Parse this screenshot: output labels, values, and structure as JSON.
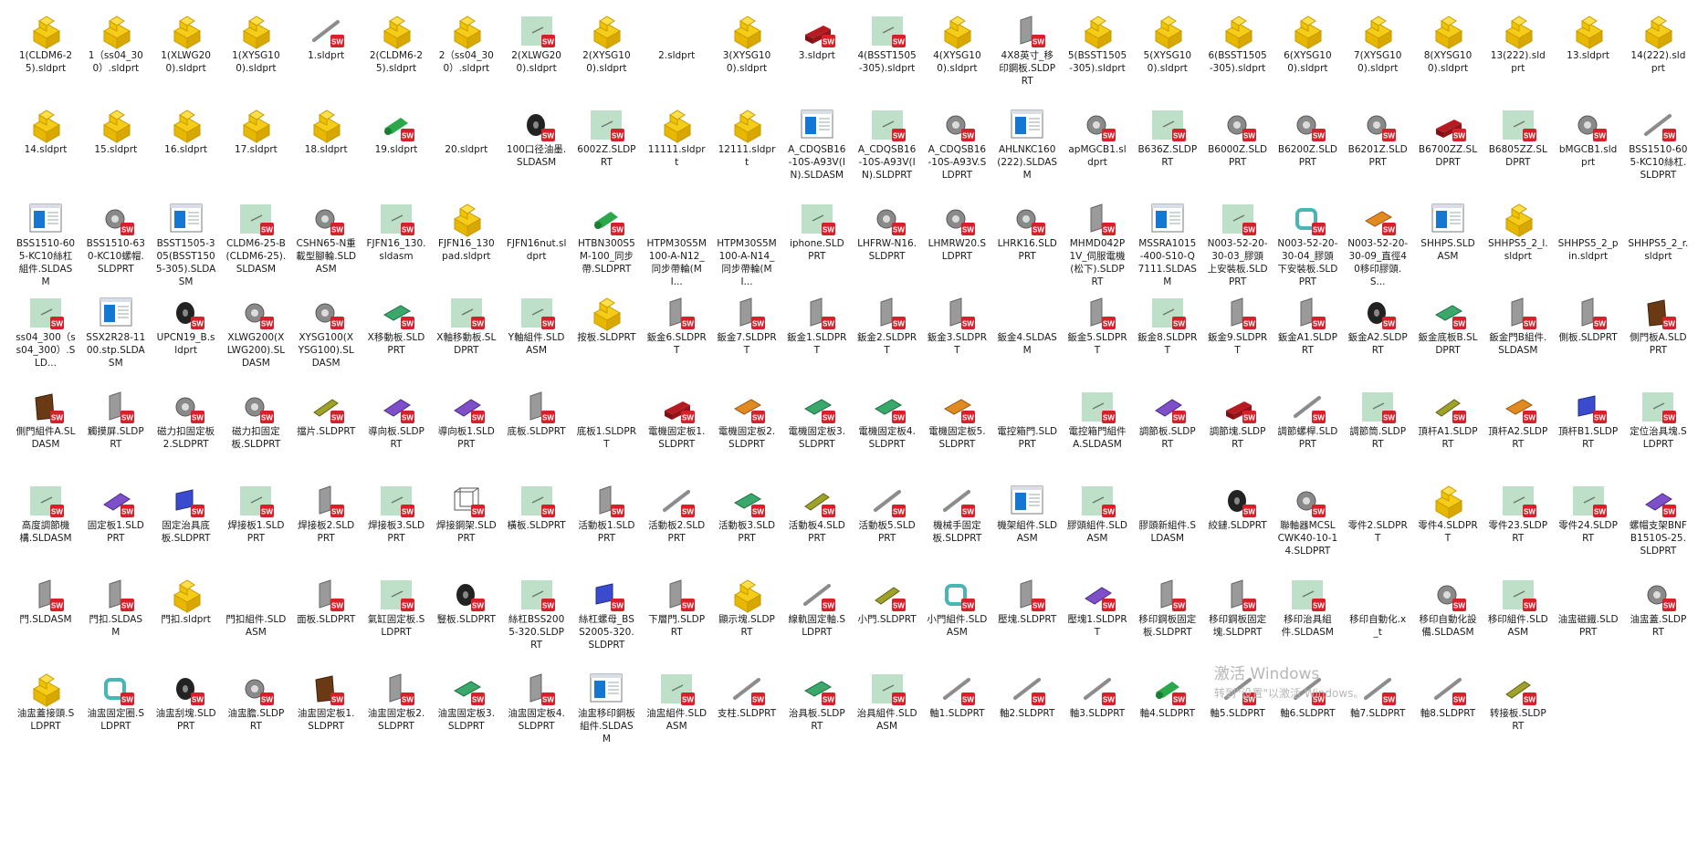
{
  "colors": {
    "folder_yellow": "#f5cc18",
    "folder_edge": "#c79a00",
    "sw_red": "#d8202a",
    "preview_green": "#bfe0c8",
    "doc_blue": "#1478d2"
  },
  "watermark": {
    "title": "激活 Windows",
    "subtitle": "转到\"设置\"以激活 Windows。"
  },
  "rows": [
    [
      {
        "label": "1(CLDM6-25).sldprt",
        "icon": "folder-part-icon"
      },
      {
        "label": "1（ss04_300）.sldprt",
        "icon": "folder-part-icon"
      },
      {
        "label": "1(XLWG200).sldprt",
        "icon": "folder-part-icon"
      },
      {
        "label": "1(XYSG100).sldprt",
        "icon": "folder-part-icon"
      },
      {
        "label": "1.sldprt",
        "icon": "rod-part-icon"
      },
      {
        "label": "2(CLDM6-25).sldprt",
        "icon": "folder-part-icon"
      },
      {
        "label": "2（ss04_300）.sldprt",
        "icon": "folder-part-icon"
      },
      {
        "label": "2(XLWG200).sldprt",
        "icon": "preview-part-icon"
      },
      {
        "label": "2(XYSG100).sldprt",
        "icon": "folder-part-icon"
      },
      {
        "label": "2.sldprt",
        "icon": "blank-icon"
      },
      {
        "label": "3(XYSG100).sldprt",
        "icon": "folder-part-icon"
      },
      {
        "label": "3.sldprt",
        "icon": "red-block-part-icon"
      },
      {
        "label": "4(BSST1505-305).sldprt",
        "icon": "preview-part-icon"
      },
      {
        "label": "4(XYSG100).sldprt",
        "icon": "folder-part-icon"
      },
      {
        "label": "4X8英寸_移印鋼板.SLDPRT",
        "icon": "gray-plate-part-icon"
      },
      {
        "label": "5(BSST1505-305).sldprt",
        "icon": "folder-part-icon"
      },
      {
        "label": "5(XYSG100).sldprt",
        "icon": "folder-part-icon"
      },
      {
        "label": "6(BSST1505-305).sldprt",
        "icon": "folder-part-icon"
      },
      {
        "label": "6(XYSG100).sldprt",
        "icon": "folder-part-icon"
      },
      {
        "label": "7(XYSG100).sldprt",
        "icon": "folder-part-icon"
      },
      {
        "label": "8(XYSG100).sldprt",
        "icon": "folder-part-icon"
      },
      {
        "label": "13(222).sldprt",
        "icon": "folder-part-icon"
      },
      {
        "label": "13.sldprt",
        "icon": "folder-part-icon"
      },
      {
        "label": "14(222).sldprt",
        "icon": "folder-part-icon"
      }
    ],
    [
      {
        "label": "14.sldprt",
        "icon": "folder-part-icon"
      },
      {
        "label": "15.sldprt",
        "icon": "folder-part-icon"
      },
      {
        "label": "16.sldprt",
        "icon": "folder-part-icon"
      },
      {
        "label": "17.sldprt",
        "icon": "folder-part-icon"
      },
      {
        "label": "18.sldprt",
        "icon": "folder-part-icon"
      },
      {
        "label": "19.sldprt",
        "icon": "green-roller-part-icon"
      },
      {
        "label": "20.sldprt",
        "icon": "blank-icon"
      },
      {
        "label": "100口径油墨.SLDASM",
        "icon": "black-wheel-icon"
      },
      {
        "label": "6002Z.SLDPRT",
        "icon": "preview-part-icon"
      },
      {
        "label": "11111.sldprt",
        "icon": "folder-part-icon"
      },
      {
        "label": "12111.sldprt",
        "icon": "folder-part-icon"
      },
      {
        "label": "A_CDQSB16-10S-A93V(IN).SLDASM",
        "icon": "assembly-window-icon"
      },
      {
        "label": "A_CDQSB16-10S-A93V(IN).SLDPRT",
        "icon": "preview-part-icon"
      },
      {
        "label": "A_CDQSB16-10S-A93V.SLDPRT",
        "icon": "gray-part-icon"
      },
      {
        "label": "AHLNKC160(222).SLDASM",
        "icon": "assembly-window-icon"
      },
      {
        "label": "apMGCB1.sldprt",
        "icon": "gray-part-icon"
      },
      {
        "label": "B636Z.SLDPRT",
        "icon": "preview-part-icon"
      },
      {
        "label": "B6000Z.SLDPRT",
        "icon": "gray-part-icon"
      },
      {
        "label": "B6200Z.SLDPRT",
        "icon": "gray-part-icon"
      },
      {
        "label": "B6201Z.SLDPRT",
        "icon": "gray-part-icon"
      },
      {
        "label": "B6700ZZ.SLDPRT",
        "icon": "red-block-part-icon"
      },
      {
        "label": "B6805ZZ.SLDPRT",
        "icon": "preview-part-icon"
      },
      {
        "label": "bMGCB1.sldprt",
        "icon": "gray-part-icon"
      },
      {
        "label": "BSS1510-605-KC10絲杠.SLDPRT",
        "icon": "rod-part-icon"
      }
    ],
    [
      {
        "label": "BSS1510-605-KC10絲杠組件.SLDASM",
        "icon": "assembly-window-icon"
      },
      {
        "label": "BSS1510-630-KC10螺帽.SLDPRT",
        "icon": "gray-part-icon"
      },
      {
        "label": "BSST1505-305(BSST1505-305).SLDASM",
        "icon": "assembly-window-icon"
      },
      {
        "label": "CLDM6-25-B(CLDM6-25).SLDASM",
        "icon": "preview-part-icon"
      },
      {
        "label": "CSHN65-N重載型腳輪.SLDASM",
        "icon": "gray-part-icon"
      },
      {
        "label": "FJFN16_130.sldasm",
        "icon": "preview-part-icon"
      },
      {
        "label": "FJFN16_130pad.sldprt",
        "icon": "folder-part-icon"
      },
      {
        "label": "FJFN16nut.sldprt",
        "icon": "blank-icon"
      },
      {
        "label": "HTBN300S5M-100_同步帶.SLDPRT",
        "icon": "green-roller-part-icon"
      },
      {
        "label": "HTPM30S5M100-A-N12_同步帶輪(MI...",
        "icon": "blank-icon"
      },
      {
        "label": "HTPM30S5M100-A-N14_同步帶輪(MI...",
        "icon": "blank-icon"
      },
      {
        "label": "iphone.SLDPRT",
        "icon": "preview-part-icon"
      },
      {
        "label": "LHFRW-N16.SLDPRT",
        "icon": "gray-part-icon"
      },
      {
        "label": "LHMRW20.SLDPRT",
        "icon": "gray-part-icon"
      },
      {
        "label": "LHRK16.SLDPRT",
        "icon": "gray-part-icon"
      },
      {
        "label": "MHMD042P1V_伺服電機(松下).SLDPRT",
        "icon": "gray-plate-part-icon"
      },
      {
        "label": "MSSRA1015-400-S10-Q7111.SLDASM",
        "icon": "assembly-window-icon"
      },
      {
        "label": "N003-52-20-30-03_膠頭上安裝板.SLDPRT",
        "icon": "preview-part-icon"
      },
      {
        "label": "N003-52-20-30-04_膠頭下安裝板.SLDPRT",
        "icon": "teal-part-icon"
      },
      {
        "label": "N003-52-20-30-09_直徑40移印膠頭.S...",
        "icon": "orange-part-icon"
      },
      {
        "label": "SHHPS.SLDASM",
        "icon": "assembly-window-icon"
      },
      {
        "label": "SHHPS5_2_l.sldprt",
        "icon": "folder-part-icon"
      },
      {
        "label": "SHHPS5_2_pin.sldprt",
        "icon": "blank-icon"
      },
      {
        "label": "SHHPS5_2_r.sldprt",
        "icon": "blank-icon"
      }
    ],
    [
      {
        "label": "ss04_300（ss04_300）.SLD...",
        "icon": "preview-part-icon"
      },
      {
        "label": "SSX2R28-1100.stp.SLDASM",
        "icon": "assembly-window-icon"
      },
      {
        "label": "UPCN19_B.sldprt",
        "icon": "black-wheel-icon"
      },
      {
        "label": "XLWG200(XLWG200).SLDASM",
        "icon": "gray-part-icon"
      },
      {
        "label": "XYSG100(XYSG100).SLDASM",
        "icon": "gray-part-icon"
      },
      {
        "label": "X移動板.SLDPRT",
        "icon": "green-plate-part-icon"
      },
      {
        "label": "X軸移動板.SLDPRT",
        "icon": "preview-part-icon"
      },
      {
        "label": "Y軸組件.SLDASM",
        "icon": "preview-part-icon"
      },
      {
        "label": "按板.SLDPRT",
        "icon": "folder-part-icon"
      },
      {
        "label": "鈑金6.SLDPRT",
        "icon": "gray-plate-part-icon"
      },
      {
        "label": "鈑金7.SLDPRT",
        "icon": "gray-plate-part-icon"
      },
      {
        "label": "鈑金1.SLDPRT",
        "icon": "gray-plate-part-icon"
      },
      {
        "label": "鈑金2.SLDPRT",
        "icon": "gray-plate-part-icon"
      },
      {
        "label": "鈑金3.SLDPRT",
        "icon": "gray-plate-part-icon"
      },
      {
        "label": "鈑金4.SLDASM",
        "icon": "blank-icon"
      },
      {
        "label": "鈑金5.SLDPRT",
        "icon": "gray-plate-part-icon"
      },
      {
        "label": "鈑金8.SLDPRT",
        "icon": "preview-part-icon"
      },
      {
        "label": "鈑金9.SLDPRT",
        "icon": "gray-plate-part-icon"
      },
      {
        "label": "鈑金A1.SLDPRT",
        "icon": "gray-plate-part-icon"
      },
      {
        "label": "鈑金A2.SLDPRT",
        "icon": "black-wheel-icon"
      },
      {
        "label": "鈑金底板B.SLDPRT",
        "icon": "green-plate-part-icon"
      },
      {
        "label": "鈑金門B組件.SLDASM",
        "icon": "gray-plate-part-icon"
      },
      {
        "label": "側板.SLDPRT",
        "icon": "gray-plate-part-icon"
      },
      {
        "label": "側門板A.SLDPRT",
        "icon": "brown-plate-part-icon"
      }
    ],
    [
      {
        "label": "側門組件A.SLDASM",
        "icon": "brown-plate-part-icon"
      },
      {
        "label": "觸摸屏.SLDPRT",
        "icon": "gray-plate-part-icon"
      },
      {
        "label": "磁力扣固定板2.SLDPRT",
        "icon": "gray-part-icon"
      },
      {
        "label": "磁力扣固定板.SLDPRT",
        "icon": "gray-part-icon"
      },
      {
        "label": "擋片.SLDPRT",
        "icon": "olive-part-icon"
      },
      {
        "label": "導向板.SLDPRT",
        "icon": "purple-part-icon"
      },
      {
        "label": "導向板1.SLDPRT",
        "icon": "purple-part-icon"
      },
      {
        "label": "底板.SLDPRT",
        "icon": "gray-plate-part-icon"
      },
      {
        "label": "底板1.SLDPRT",
        "icon": "blank-icon"
      },
      {
        "label": "電機固定板1.SLDPRT",
        "icon": "red-block-part-icon"
      },
      {
        "label": "電機固定板2.SLDPRT",
        "icon": "orange-part-icon"
      },
      {
        "label": "電機固定板3.SLDPRT",
        "icon": "green-plate-part-icon"
      },
      {
        "label": "電機固定板4.SLDPRT",
        "icon": "green-plate-part-icon"
      },
      {
        "label": "電機固定板5.SLDPRT",
        "icon": "orange-part-icon"
      },
      {
        "label": "電控箱門.SLDPRT",
        "icon": "blank-icon"
      },
      {
        "label": "電控箱門組件A.SLDASM",
        "icon": "preview-part-icon"
      },
      {
        "label": "調節板.SLDPRT",
        "icon": "purple-part-icon"
      },
      {
        "label": "調節塊.SLDPRT",
        "icon": "red-block-part-icon"
      },
      {
        "label": "調節螺桿.SLDPRT",
        "icon": "rod-part-icon"
      },
      {
        "label": "調節筒.SLDPRT",
        "icon": "preview-part-icon"
      },
      {
        "label": "頂杆A1.SLDPRT",
        "icon": "olive-part-icon"
      },
      {
        "label": "頂杆A2.SLDPRT",
        "icon": "orange-part-icon"
      },
      {
        "label": "頂杆B1.SLDPRT",
        "icon": "blue-part-icon"
      },
      {
        "label": "定位治具塊.SLDPRT",
        "icon": "preview-part-icon"
      }
    ],
    [
      {
        "label": "高度調節機構.SLDASM",
        "icon": "preview-part-icon"
      },
      {
        "label": "固定板1.SLDPRT",
        "icon": "purple-part-icon"
      },
      {
        "label": "固定治具底板.SLDPRT",
        "icon": "blue-part-icon"
      },
      {
        "label": "焊接板1.SLDPRT",
        "icon": "preview-part-icon"
      },
      {
        "label": "焊接板2.SLDPRT",
        "icon": "gray-plate-part-icon"
      },
      {
        "label": "焊接板3.SLDPRT",
        "icon": "preview-part-icon"
      },
      {
        "label": "焊接鋼架.SLDPRT",
        "icon": "frame-part-icon"
      },
      {
        "label": "橫板.SLDPRT",
        "icon": "preview-part-icon"
      },
      {
        "label": "活動板1.SLDPRT",
        "icon": "gray-plate-part-icon"
      },
      {
        "label": "活動板2.SLDPRT",
        "icon": "rod-part-icon"
      },
      {
        "label": "活動板3.SLDPRT",
        "icon": "green-plate-part-icon"
      },
      {
        "label": "活動板4.SLDPRT",
        "icon": "olive-part-icon"
      },
      {
        "label": "活動板5.SLDPRT",
        "icon": "rod-part-icon"
      },
      {
        "label": "機械手固定板.SLDPRT",
        "icon": "rod-part-icon"
      },
      {
        "label": "機架組件.SLDASM",
        "icon": "assembly-window-icon"
      },
      {
        "label": "膠頭組件.SLDASM",
        "icon": "preview-part-icon"
      },
      {
        "label": "膠頭新組件.SLDASM",
        "icon": "blank-icon"
      },
      {
        "label": "絞鏈.SLDPRT",
        "icon": "black-wheel-icon"
      },
      {
        "label": "聯軸器MCSLCWK40-10-14.SLDPRT",
        "icon": "gray-part-icon"
      },
      {
        "label": "零件2.SLDPRT",
        "icon": "blank-icon"
      },
      {
        "label": "零件4.SLDPRT",
        "icon": "folder-part-icon"
      },
      {
        "label": "零件23.SLDPRT",
        "icon": "preview-part-icon"
      },
      {
        "label": "零件24.SLDPRT",
        "icon": "preview-part-icon"
      },
      {
        "label": "螺帽支架BNFB1510S-25.SLDPRT",
        "icon": "purple-part-icon"
      }
    ],
    [
      {
        "label": "門.SLDASM",
        "icon": "gray-plate-part-icon"
      },
      {
        "label": "門扣.SLDASM",
        "icon": "gray-plate-part-icon"
      },
      {
        "label": "門扣.sldprt",
        "icon": "folder-part-icon"
      },
      {
        "label": "門扣組件.SLDASM",
        "icon": "blank-icon"
      },
      {
        "label": "面板.SLDPRT",
        "icon": "gray-plate-part-icon"
      },
      {
        "label": "氣缸固定板.SLDPRT",
        "icon": "preview-part-icon"
      },
      {
        "label": "豎板.SLDPRT",
        "icon": "black-wheel-icon"
      },
      {
        "label": "絲杠BSS2005-320.SLDPRT",
        "icon": "preview-part-icon"
      },
      {
        "label": "絲杠螺母_BSS2005-320.SLDPRT",
        "icon": "blue-part-icon"
      },
      {
        "label": "下層門.SLDPRT",
        "icon": "gray-plate-part-icon"
      },
      {
        "label": "顯示塊.SLDPRT",
        "icon": "folder-part-icon"
      },
      {
        "label": "線軌固定軸.SLDPRT",
        "icon": "rod-part-icon"
      },
      {
        "label": "小門.SLDPRT",
        "icon": "olive-part-icon"
      },
      {
        "label": "小門組件.SLDASM",
        "icon": "teal-part-icon"
      },
      {
        "label": "壓塊.SLDPRT",
        "icon": "gray-plate-part-icon"
      },
      {
        "label": "壓塊1.SLDPRT",
        "icon": "purple-part-icon"
      },
      {
        "label": "移印鋼板固定板.SLDPRT",
        "icon": "gray-plate-part-icon"
      },
      {
        "label": "移印鋼板固定塊.SLDPRT",
        "icon": "gray-plate-part-icon"
      },
      {
        "label": "移印治具組件.SLDASM",
        "icon": "preview-part-icon"
      },
      {
        "label": "移印自動化.x_t",
        "icon": "blank-icon"
      },
      {
        "label": "移印自動化設備.SLDASM",
        "icon": "gray-part-icon"
      },
      {
        "label": "移印組件.SLDASM",
        "icon": "preview-part-icon"
      },
      {
        "label": "油盅磁鐵.SLDPRT",
        "icon": "blank-icon"
      },
      {
        "label": "油盅蓋.SLDPRT",
        "icon": "gray-part-icon"
      }
    ],
    [
      {
        "label": "油盅蓋接頭.SLDPRT",
        "icon": "folder-part-icon"
      },
      {
        "label": "油盅固定圈.SLDPRT",
        "icon": "teal-part-icon"
      },
      {
        "label": "油盅刮塊.SLDPRT",
        "icon": "black-wheel-icon"
      },
      {
        "label": "油盅膽.SLDPRT",
        "icon": "gray-part-icon"
      },
      {
        "label": "油盅固定板1.SLDPRT",
        "icon": "brown-plate-part-icon"
      },
      {
        "label": "油盅固定板2.SLDPRT",
        "icon": "gray-plate-part-icon"
      },
      {
        "label": "油盅固定板3.SLDPRT",
        "icon": "green-plate-part-icon"
      },
      {
        "label": "油盅固定板4.SLDPRT",
        "icon": "gray-plate-part-icon"
      },
      {
        "label": "油盅移印鋼板組件.SLDASM",
        "icon": "assembly-window-icon"
      },
      {
        "label": "油盅組件.SLDASM",
        "icon": "preview-part-icon"
      },
      {
        "label": "支柱.SLDPRT",
        "icon": "rod-part-icon"
      },
      {
        "label": "治具板.SLDPRT",
        "icon": "green-plate-part-icon"
      },
      {
        "label": "治具組件.SLDASM",
        "icon": "preview-part-icon"
      },
      {
        "label": "軸1.SLDPRT",
        "icon": "rod-part-icon"
      },
      {
        "label": "軸2.SLDPRT",
        "icon": "rod-part-icon"
      },
      {
        "label": "軸3.SLDPRT",
        "icon": "rod-part-icon"
      },
      {
        "label": "軸4.SLDPRT",
        "icon": "green-roller-part-icon"
      },
      {
        "label": "軸5.SLDPRT",
        "icon": "rod-part-icon"
      },
      {
        "label": "軸6.SLDPRT",
        "icon": "rod-part-icon"
      },
      {
        "label": "軸7.SLDPRT",
        "icon": "rod-part-icon"
      },
      {
        "label": "軸8.SLDPRT",
        "icon": "rod-part-icon"
      },
      {
        "label": "转接板.SLDPRT",
        "icon": "olive-part-icon"
      }
    ]
  ]
}
